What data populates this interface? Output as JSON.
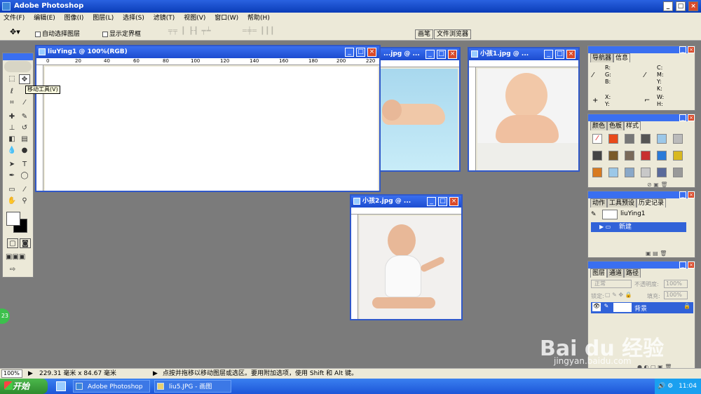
{
  "app": {
    "title": "Adobe Photoshop"
  },
  "menu": [
    "文件(F)",
    "编辑(E)",
    "图像(I)",
    "图层(L)",
    "选择(S)",
    "滤镜(T)",
    "视图(V)",
    "窗口(W)",
    "帮助(H)"
  ],
  "options": {
    "auto_select": "自动选择图层",
    "show_bounds": "显示定界框",
    "brushes_tab": "画笔",
    "browser_tab": "文件浏览器"
  },
  "tooltip": "移动工具(V)",
  "docs": {
    "main": {
      "title": "liuYing1 @ 100%(RGB)",
      "ruler": [
        "0",
        "20",
        "40",
        "60",
        "80",
        "100",
        "120",
        "140",
        "160",
        "180",
        "200",
        "220"
      ]
    },
    "baby_sleep": {
      "title": "...jpg @ ..."
    },
    "child1": {
      "title": "小孩1.jpg @ ..."
    },
    "child2": {
      "title": "小孩2.jpg @ ..."
    }
  },
  "panels": {
    "nav": {
      "tabs": [
        "导航器",
        "信息"
      ],
      "rgb": "R:\nG:\nB:",
      "cmyk": "C:\nM:\nY:\nK:",
      "xy": "X:\nY:",
      "wh": "W:\nH:"
    },
    "styles": {
      "tabs": [
        "颜色",
        "色板",
        "样式"
      ]
    },
    "history": {
      "tabs": [
        "动作",
        "工具预设",
        "历史记录"
      ],
      "snapshot": "liuYing1",
      "item": "新建"
    },
    "layers": {
      "tabs": [
        "图层",
        "通道",
        "路径"
      ],
      "mode": "正常",
      "opacity_label": "不透明度:",
      "opacity": "100%",
      "lock_label": "锁定:",
      "fill_label": "填充:",
      "fill": "100%",
      "layer_name": "背景"
    }
  },
  "status": {
    "zoom": "100%",
    "size": "229.31 毫米 x 84.67 毫米",
    "hint": "点按并拖移以移动图层或选区。要用附加选项，使用 Shift 和 Alt 键。"
  },
  "taskbar": {
    "start": "开始",
    "task1": "Adobe Photoshop",
    "task2": "liu5.JPG - 画图",
    "clock": "11:04"
  },
  "watermark": {
    "brand": "Bai du 经验",
    "url": "jingyan.baidu.com"
  },
  "badge": "23"
}
